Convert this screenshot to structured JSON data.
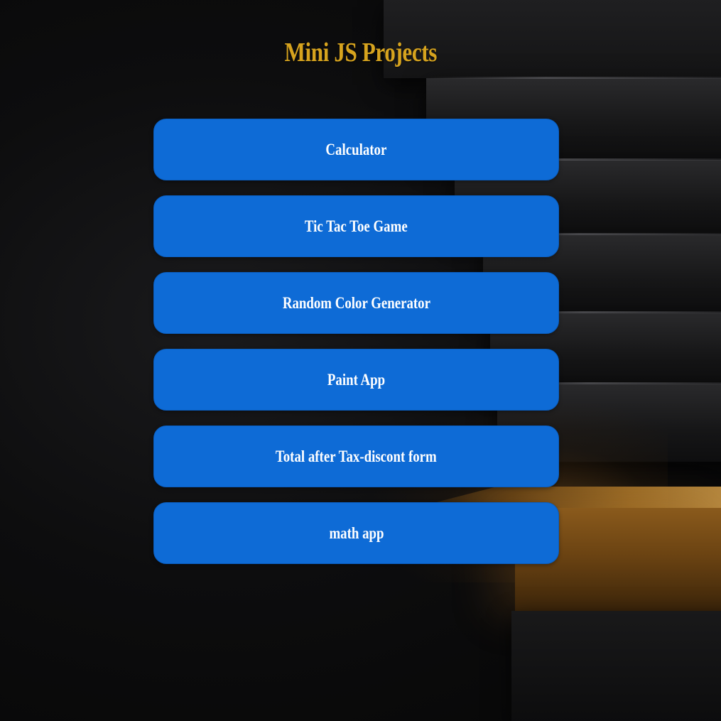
{
  "page": {
    "title": "Mini JS Projects"
  },
  "projects": [
    {
      "label": "Calculator"
    },
    {
      "label": "Tic Tac Toe Game"
    },
    {
      "label": "Random Color Generator"
    },
    {
      "label": "Paint App"
    },
    {
      "label": "Total after Tax-discont form"
    },
    {
      "label": "math app"
    }
  ],
  "colors": {
    "title": "#d6a31e",
    "button_bg": "#0e6bd6",
    "button_text": "#ffffff",
    "background": "#0b0b0c"
  }
}
